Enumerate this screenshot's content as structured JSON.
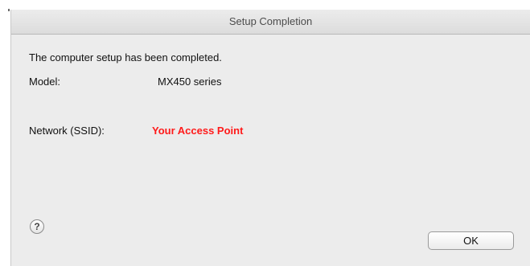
{
  "window": {
    "title": "Setup Completion"
  },
  "content": {
    "message": "The computer setup has been completed.",
    "model_label": "Model:",
    "model_value": "MX450 series",
    "network_label": "Network (SSID):",
    "network_value": "Your Access Point"
  },
  "colors": {
    "network_value": "#ff1a1a",
    "window_bg": "#ececec"
  },
  "buttons": {
    "help_icon": "question-mark",
    "help_glyph": "?",
    "ok_label": "OK"
  }
}
